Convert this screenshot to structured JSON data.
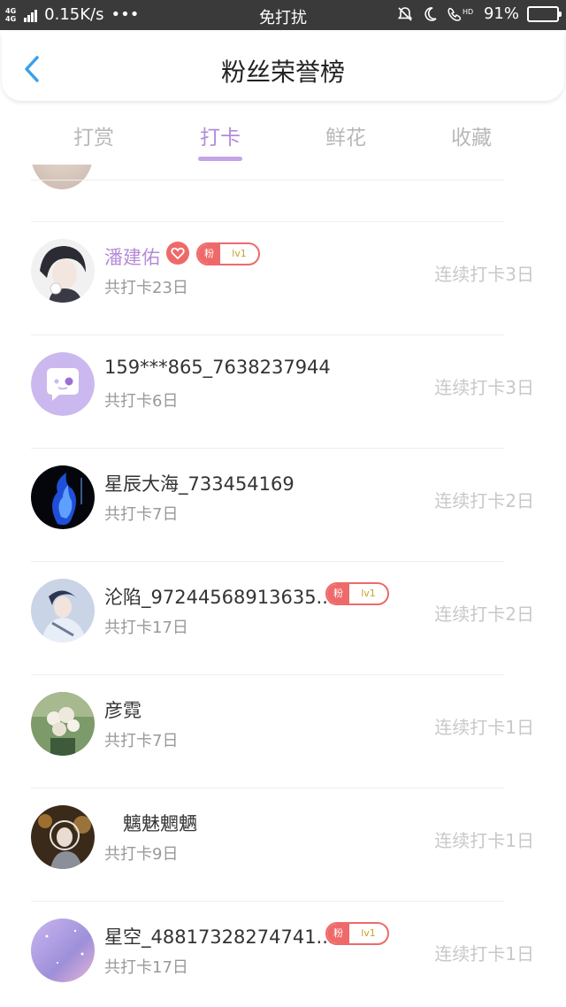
{
  "status_bar": {
    "network_top": "4G",
    "network_bottom": "4G",
    "speed": "0.15K/s",
    "dots": "•••",
    "mode": "免打扰",
    "hd": "HD",
    "battery": "91%",
    "battery_level": 0.91,
    "battery_color": "#2ecc40"
  },
  "header": {
    "title": "粉丝荣誉榜",
    "back_icon": "chevron-left-icon",
    "back_color": "#3aa0ea"
  },
  "tabs": [
    {
      "label": "打赏",
      "active": false
    },
    {
      "label": "打卡",
      "active": true
    },
    {
      "label": "鲜花",
      "active": false
    },
    {
      "label": "收藏",
      "active": false
    }
  ],
  "accent_color": "#b38bd9",
  "badge_color": "#ee6a6a",
  "list": [
    {
      "name": "潘建佑",
      "total": "共打卡23日",
      "streak": "连续打卡3日",
      "badge": {
        "left": "粉",
        "right": "lv1"
      },
      "heart_icon": "heart-icon"
    },
    {
      "name": "159***865_7638237944",
      "total": "共打卡6日",
      "streak": "连续打卡3日"
    },
    {
      "name": "星辰大海_733454169",
      "total": "共打卡7日",
      "streak": "连续打卡2日"
    },
    {
      "name": "沦陷_97244568913635...",
      "total": "共打卡17日",
      "streak": "连续打卡2日",
      "badge": {
        "left": "粉",
        "right": "lv1"
      }
    },
    {
      "name": "彦霓",
      "total": "共打卡7日",
      "streak": "连续打卡1日"
    },
    {
      "name": "　魑魅魍魉",
      "total": "共打卡9日",
      "streak": "连续打卡1日"
    },
    {
      "name": "星空_48817328274741...",
      "total": "共打卡17日",
      "streak": "连续打卡1日",
      "badge": {
        "left": "粉",
        "right": "lv1"
      }
    }
  ]
}
